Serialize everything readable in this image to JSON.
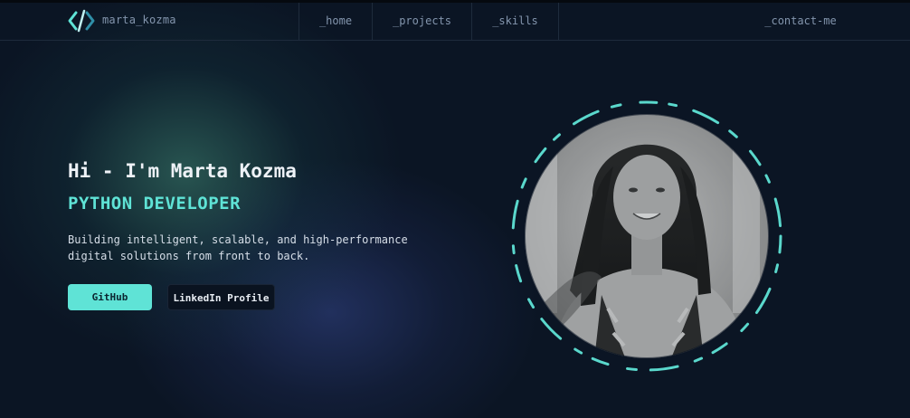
{
  "navbar": {
    "brand": "marta_kozma",
    "logo_icon": "code-brackets-icon",
    "items": [
      "_home",
      "_projects",
      "_skills"
    ],
    "contact": "_contact-me"
  },
  "hero": {
    "greeting": "Hi - I'm Marta Kozma",
    "role": "PYTHON DEVELOPER",
    "description": "Building intelligent, scalable, and high-performance digital solutions from front to back.",
    "buttons": {
      "github": "GitHub",
      "linkedin": "LinkedIn Profile"
    },
    "portrait": "grayscale-portrait-photo"
  },
  "colors": {
    "accent": "#5fe3d6",
    "background": "#0b1524",
    "nav_text": "#8395ad"
  }
}
